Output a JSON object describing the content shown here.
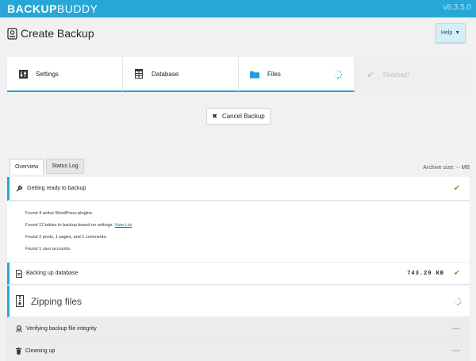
{
  "header": {
    "logo_bold": "BACKUP",
    "logo_light": "BUDDY",
    "version": "v8.3.5.0"
  },
  "page": {
    "title": "Create Backup",
    "help_label": "Help"
  },
  "steps": [
    {
      "label": "Settings",
      "icon": "sliders-icon",
      "state": "done"
    },
    {
      "label": "Database",
      "icon": "table-icon",
      "state": "done"
    },
    {
      "label": "Files",
      "icon": "folder-icon",
      "state": "active"
    },
    {
      "label": "Finished!",
      "icon": "check-icon",
      "state": "pending"
    }
  ],
  "cancel_label": "Cancel Backup",
  "tabs": [
    {
      "label": "Overview",
      "active": true
    },
    {
      "label": "Status Log",
      "active": false
    }
  ],
  "archive_size": "Archive size: -- MB",
  "progress": {
    "ready": {
      "label": "Getting ready to backup",
      "icon": "wrench-icon"
    },
    "details": [
      {
        "text": "Found 4 active WordPress plugins."
      },
      {
        "text": "Found 12 tables to backup based on settings.",
        "link": "View List"
      },
      {
        "text": "Found 2 posts, 1 pages, and 1 comments."
      },
      {
        "text": "Found 1 user accounts."
      }
    ],
    "database": {
      "label": "Backing up database",
      "size": "743.20 KB",
      "icon": "file-icon"
    },
    "zipping": {
      "label": "Zipping files",
      "icon": "zip-icon"
    },
    "verify": {
      "label": "Verifying backup file integrity",
      "icon": "hazard-icon"
    },
    "cleanup": {
      "label": "Cleaning up",
      "icon": "trash-icon"
    }
  },
  "colors": {
    "accent": "#27a7d6",
    "success": "#4fb33b"
  }
}
